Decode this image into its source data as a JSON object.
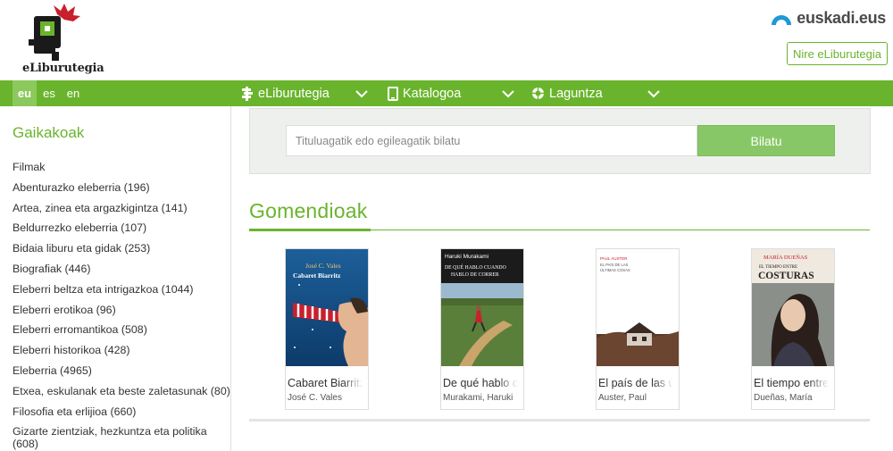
{
  "header": {
    "logo_text": "eLiburutegia",
    "euskadi_text": "euskadi.eus",
    "nire_button": "Nire eLiburutegia"
  },
  "languages": [
    {
      "code": "eu",
      "active": true
    },
    {
      "code": "es",
      "active": false
    },
    {
      "code": "en",
      "active": false
    }
  ],
  "nav": {
    "items": [
      {
        "label": "eLiburutegia",
        "icon": "book-stack-icon"
      },
      {
        "label": "Katalogoa",
        "icon": "tablet-icon"
      },
      {
        "label": "Laguntza",
        "icon": "lifebuoy-icon"
      }
    ]
  },
  "sidebar": {
    "title": "Gaikakoak",
    "categories": [
      "Filmak",
      "Abenturazko eleberria (196)",
      "Artea, zinea eta argazkigintza (141)",
      "Beldurrezko eleberria (107)",
      "Bidaia liburu eta gidak (253)",
      "Biografiak (446)",
      "Eleberri beltza eta intrigazkoa (1044)",
      "Eleberri erotikoa (96)",
      "Eleberri erromantikoa (508)",
      "Eleberri historikoa (428)",
      "Eleberria (4965)",
      "Etxea, eskulanak eta beste zaletasunak (80)",
      "Filosofia eta erlijioa (660)",
      "Gizarte zientziak, hezkuntza eta politika (608)"
    ]
  },
  "search": {
    "placeholder": "Tituluagatik edo egileagatik bilatu",
    "button": "Bilatu"
  },
  "recommendations": {
    "title": "Gomendioak",
    "books": [
      {
        "title": "Cabaret Biarritz",
        "author": "José C. Vales",
        "cover_author": "José C. Vales",
        "cover_title": "Cabaret Biarritz"
      },
      {
        "title": "De qué hablo cuando hablo de correr",
        "author": "Murakami, Haruki",
        "cover_author": "Haruki Murakami",
        "cover_title": "DE QUÉ HABLO CUANDO HABLO DE CORRER"
      },
      {
        "title": "El país de las últimas cosas",
        "author": "Auster, Paul",
        "cover_author": "PAUL AUSTER",
        "cover_title": "EL PAÍS DE LAS ÚLTIMAS COSAS"
      },
      {
        "title": "El tiempo entre costuras",
        "author": "Dueñas, María",
        "cover_author": "MARÍA DUEÑAS",
        "cover_title_top": "EL TIEMPO ENTRE",
        "cover_title_bottom": "COSTURAS"
      }
    ]
  },
  "colors": {
    "brand_green": "#6ab42d",
    "search_button": "#88c767",
    "euskadi_blue": "#1e9ad6"
  }
}
